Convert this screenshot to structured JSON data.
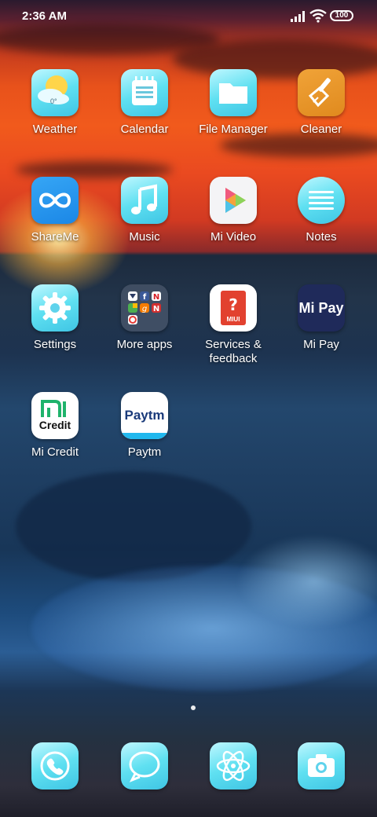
{
  "status": {
    "time": "2:36 AM",
    "battery": "100"
  },
  "apps": [
    {
      "label": "Weather",
      "icon": "weather-icon",
      "temp": "0°"
    },
    {
      "label": "Calendar",
      "icon": "calendar-icon"
    },
    {
      "label": "File Manager",
      "icon": "folder-icon"
    },
    {
      "label": "Cleaner",
      "icon": "broom-icon"
    },
    {
      "label": "ShareMe",
      "icon": "infinity-icon"
    },
    {
      "label": "Music",
      "icon": "music-note-icon"
    },
    {
      "label": "Mi Video",
      "icon": "play-icon"
    },
    {
      "label": "Notes",
      "icon": "notes-icon"
    },
    {
      "label": "Settings",
      "icon": "gear-icon"
    },
    {
      "label": "More apps",
      "icon": "folder-apps-icon"
    },
    {
      "label": "Services & feedback",
      "icon": "help-icon",
      "badge": "MIUI"
    },
    {
      "label": "Mi Pay",
      "icon": "mipay-icon",
      "logo": "Mi Pay"
    },
    {
      "label": "Mi Credit",
      "icon": "micredit-icon",
      "logo": "Credit"
    },
    {
      "label": "Paytm",
      "icon": "paytm-icon",
      "logo": "Paytm"
    }
  ],
  "dock": [
    {
      "name": "phone-icon"
    },
    {
      "name": "messages-icon"
    },
    {
      "name": "browser-icon"
    },
    {
      "name": "camera-icon"
    }
  ]
}
